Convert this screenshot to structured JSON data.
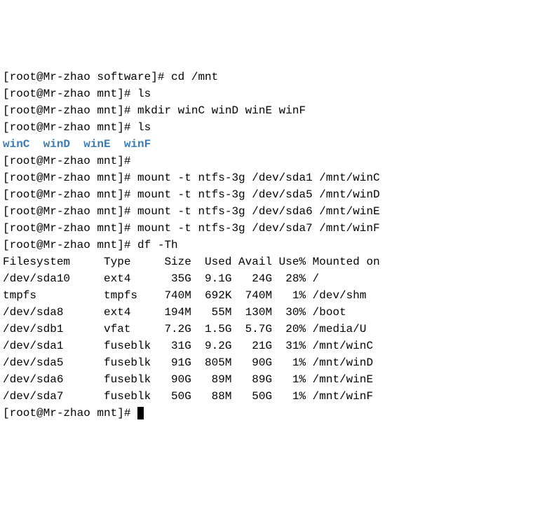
{
  "prompts": [
    {
      "user": "root",
      "host": "Mr-zhao",
      "cwd": "software",
      "cmd": "cd /mnt"
    },
    {
      "user": "root",
      "host": "Mr-zhao",
      "cwd": "mnt",
      "cmd": "ls"
    },
    {
      "user": "root",
      "host": "Mr-zhao",
      "cwd": "mnt",
      "cmd": "mkdir winC winD winE winF"
    },
    {
      "user": "root",
      "host": "Mr-zhao",
      "cwd": "mnt",
      "cmd": "ls"
    }
  ],
  "ls_output": "winC  winD  winE  winF",
  "prompts2": [
    {
      "user": "root",
      "host": "Mr-zhao",
      "cwd": "mnt",
      "cmd": ""
    },
    {
      "user": "root",
      "host": "Mr-zhao",
      "cwd": "mnt",
      "cmd": "mount -t ntfs-3g /dev/sda1 /mnt/winC"
    },
    {
      "user": "root",
      "host": "Mr-zhao",
      "cwd": "mnt",
      "cmd": "mount -t ntfs-3g /dev/sda5 /mnt/winD"
    },
    {
      "user": "root",
      "host": "Mr-zhao",
      "cwd": "mnt",
      "cmd": "mount -t ntfs-3g /dev/sda6 /mnt/winE"
    },
    {
      "user": "root",
      "host": "Mr-zhao",
      "cwd": "mnt",
      "cmd": "mount -t ntfs-3g /dev/sda7 /mnt/winF"
    },
    {
      "user": "root",
      "host": "Mr-zhao",
      "cwd": "mnt",
      "cmd": "df -Th"
    }
  ],
  "df_header": "Filesystem     Type     Size  Used Avail Use% Mounted on",
  "df_rows": [
    {
      "fs": "/dev/sda10",
      "type": "ext4",
      "size": "35G",
      "used": "9.1G",
      "avail": "24G",
      "usepct": "28%",
      "mount": "/"
    },
    {
      "fs": "tmpfs",
      "type": "tmpfs",
      "size": "740M",
      "used": "692K",
      "avail": "740M",
      "usepct": "1%",
      "mount": "/dev/shm"
    },
    {
      "fs": "/dev/sda8",
      "type": "ext4",
      "size": "194M",
      "used": "55M",
      "avail": "130M",
      "usepct": "30%",
      "mount": "/boot"
    },
    {
      "fs": "/dev/sdb1",
      "type": "vfat",
      "size": "7.2G",
      "used": "1.5G",
      "avail": "5.7G",
      "usepct": "20%",
      "mount": "/media/U"
    },
    {
      "fs": "/dev/sda1",
      "type": "fuseblk",
      "size": "31G",
      "used": "9.2G",
      "avail": "21G",
      "usepct": "31%",
      "mount": "/mnt/winC"
    },
    {
      "fs": "/dev/sda5",
      "type": "fuseblk",
      "size": "91G",
      "used": "805M",
      "avail": "90G",
      "usepct": "1%",
      "mount": "/mnt/winD"
    },
    {
      "fs": "/dev/sda6",
      "type": "fuseblk",
      "size": "90G",
      "used": "89M",
      "avail": "89G",
      "usepct": "1%",
      "mount": "/mnt/winE"
    },
    {
      "fs": "/dev/sda7",
      "type": "fuseblk",
      "size": "50G",
      "used": "88M",
      "avail": "50G",
      "usepct": "1%",
      "mount": "/mnt/winF"
    }
  ],
  "final_prompt": {
    "user": "root",
    "host": "Mr-zhao",
    "cwd": "mnt"
  }
}
